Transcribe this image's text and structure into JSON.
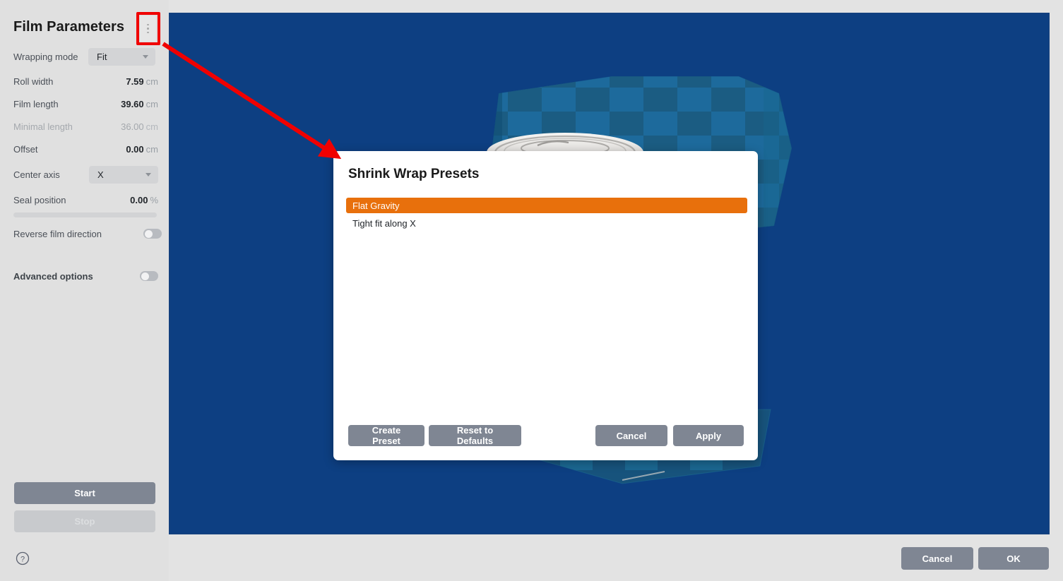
{
  "sidebar": {
    "title": "Film Parameters",
    "menu_icon": "kebab-menu-icon",
    "fields": [
      {
        "label": "Wrapping mode",
        "type": "dropdown",
        "value": "Fit"
      },
      {
        "label": "Roll width",
        "type": "value",
        "value": "7.59",
        "unit": "cm"
      },
      {
        "label": "Film length",
        "type": "value",
        "value": "39.60",
        "unit": "cm"
      },
      {
        "label": "Minimal length",
        "type": "value",
        "value": "36.00",
        "unit": "cm",
        "disabled": true
      },
      {
        "label": "Offset",
        "type": "value",
        "value": "0.00",
        "unit": "cm"
      },
      {
        "label": "Center axis",
        "type": "dropdown",
        "value": "X"
      },
      {
        "label": "Seal position",
        "type": "value",
        "value": "0.00",
        "unit": "%"
      },
      {
        "label": "Reverse film direction",
        "type": "toggle",
        "value": "off"
      },
      {
        "label": "Advanced options",
        "type": "toggle",
        "value": "off"
      }
    ],
    "start_label": "Start",
    "stop_label": "Stop",
    "help_icon": "help-circle-icon"
  },
  "viewport": {
    "background_color": "#0d3f82",
    "scene": "3d-shrink-wrapped-can-preview"
  },
  "modal": {
    "title": "Shrink Wrap Presets",
    "presets": [
      {
        "label": "Flat Gravity",
        "selected": true
      },
      {
        "label": "Tight fit along X",
        "selected": false
      }
    ],
    "create_preset_label": "Create Preset",
    "reset_defaults_label": "Reset to Defaults",
    "cancel_label": "Cancel",
    "apply_label": "Apply",
    "selection_color": "#e8700c"
  },
  "footer": {
    "cancel_label": "Cancel",
    "ok_label": "OK"
  },
  "annotation": {
    "highlight_color": "#f00000",
    "target": "kebab-menu-button",
    "points_to": "shrink-wrap-presets-dialog"
  }
}
